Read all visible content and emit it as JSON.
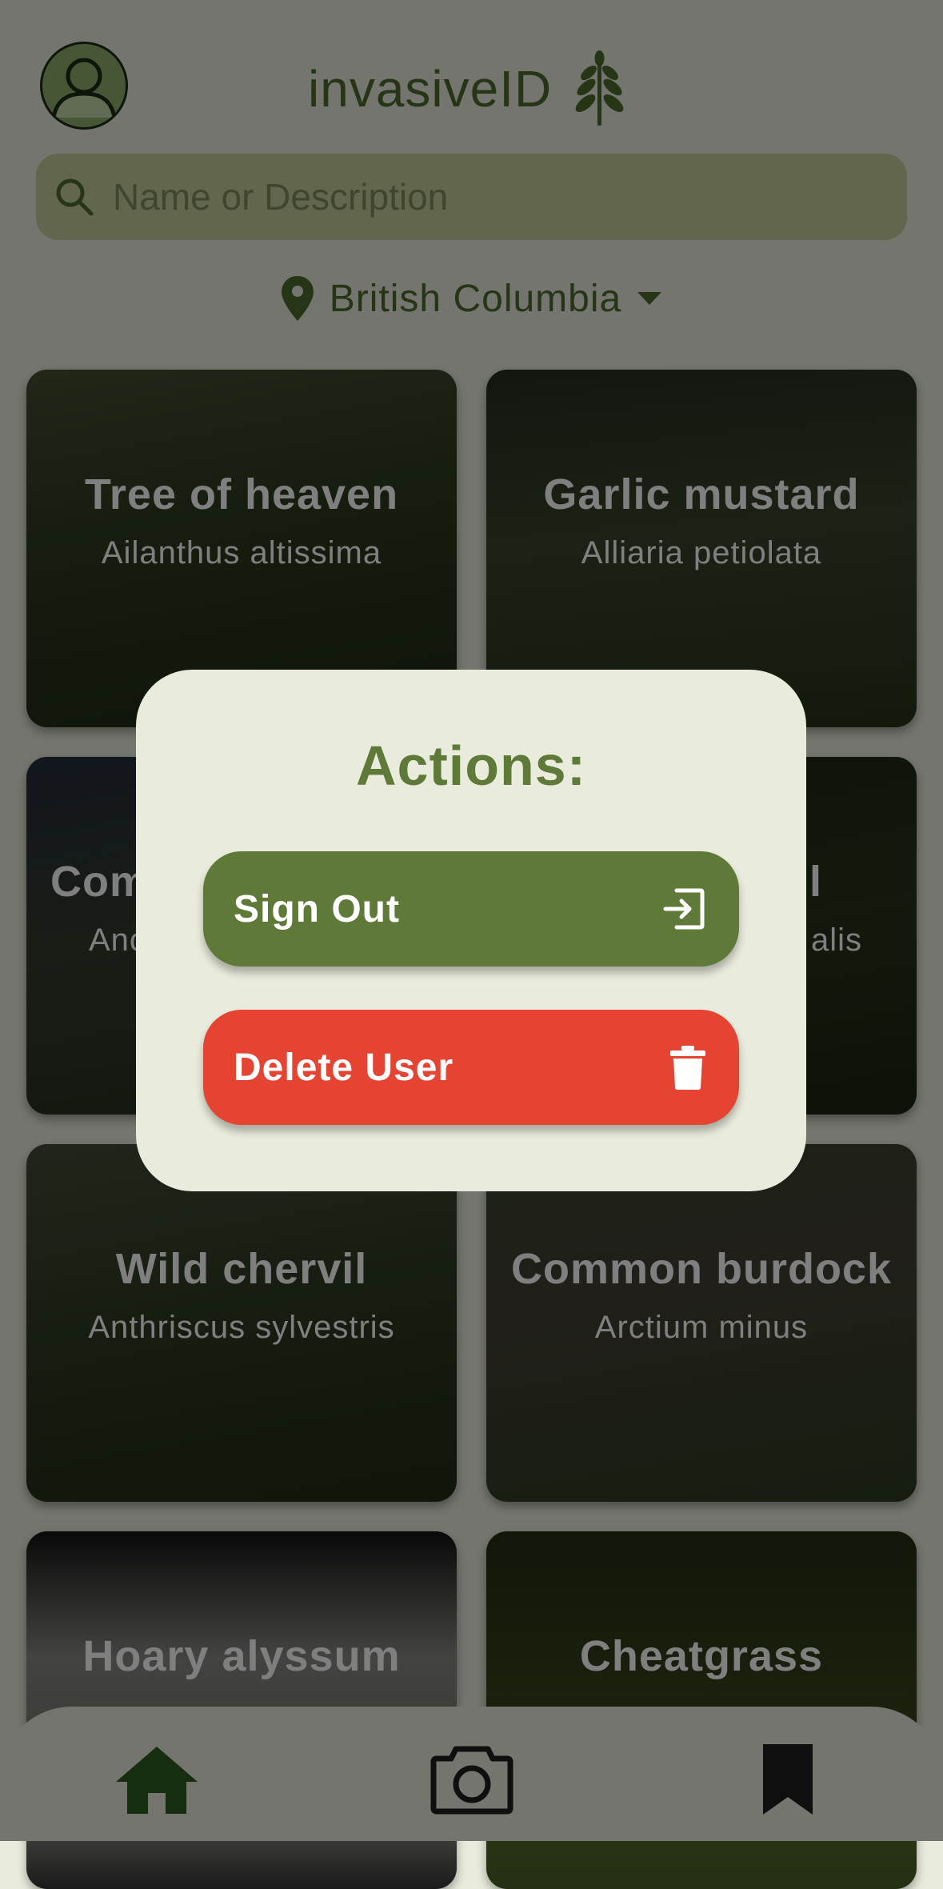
{
  "header": {
    "app_title": "invasiveID",
    "avatar_icon": "user-avatar-icon",
    "logo_icon": "fern-leaf-icon"
  },
  "search": {
    "placeholder": "Name or Description",
    "value": ""
  },
  "region": {
    "label": "British Columbia",
    "icon": "map-pin-icon"
  },
  "cards": [
    {
      "name": "Tree of heaven",
      "scientific": "Ailanthus altissima"
    },
    {
      "name": "Garlic mustard",
      "scientific": "Alliaria petiolata"
    },
    {
      "name": "Com",
      "scientific": "Anc"
    },
    {
      "name": "l",
      "scientific": "alis"
    },
    {
      "name": "Wild chervil",
      "scientific": "Anthriscus sylvestris"
    },
    {
      "name": "Common burdock",
      "scientific": "Arctium minus"
    },
    {
      "name": "Hoary alyssum",
      "scientific": ""
    },
    {
      "name": "Cheatgrass",
      "scientific": ""
    }
  ],
  "modal": {
    "title": "Actions:",
    "sign_out_label": "Sign Out",
    "delete_user_label": "Delete User"
  },
  "nav": {
    "home_icon": "home-icon",
    "camera_icon": "camera-icon",
    "bookmark_icon": "bookmark-icon"
  },
  "colors": {
    "brand_green": "#5f7a38",
    "dark_green": "#4c6a2c",
    "danger_red": "#e54433",
    "background": "#e9ebdc",
    "search_bg": "#c5cc9a"
  }
}
